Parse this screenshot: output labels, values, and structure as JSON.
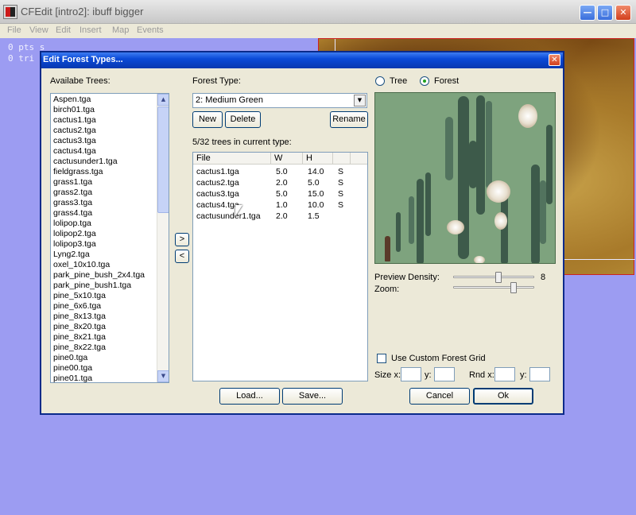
{
  "app": {
    "title": "CFEdit [intro2]: ibuff bigger",
    "menu": [
      "File",
      "View",
      "Edit",
      "Insert",
      "Map",
      "Events"
    ],
    "console": [
      "0 pts s",
      "0 tri"
    ]
  },
  "dialog": {
    "title": "Edit Forest Types...",
    "available_label": "Availabe Trees:",
    "available_trees": [
      "Aspen.tga",
      "birch01.tga",
      "cactus1.tga",
      "cactus2.tga",
      "cactus3.tga",
      "cactus4.tga",
      "cactusunder1.tga",
      "fieldgrass.tga",
      "grass1.tga",
      "grass2.tga",
      "grass3.tga",
      "grass4.tga",
      "lolipop.tga",
      "lolipop2.tga",
      "lolipop3.tga",
      "Lyng2.tga",
      "oxel_10x10.tga",
      "park_pine_bush_2x4.tga",
      "park_pine_bush1.tga",
      "pine_5x10.tga",
      "pine_6x6.tga",
      "pine_8x13.tga",
      "pine_8x20.tga",
      "pine_8x21.tga",
      "pine_8x22.tga",
      "pine0.tga",
      "pine00.tga",
      "pine01.tga"
    ],
    "forest_type_label": "Forest Type:",
    "forest_type_value": "2: Medium Green",
    "new_label": "New",
    "delete_label": "Delete",
    "rename_label": "Rename",
    "count_label": "5/32 trees in current type:",
    "columns": [
      "File",
      "W",
      "H",
      ""
    ],
    "rows": [
      {
        "file": "cactus1.tga",
        "w": "5.0",
        "h": "14.0",
        "s": "S"
      },
      {
        "file": "cactus2.tga",
        "w": "2.0",
        "h": "5.0",
        "s": "S"
      },
      {
        "file": "cactus3.tga",
        "w": "5.0",
        "h": "15.0",
        "s": "S"
      },
      {
        "file": "cactus4.tga",
        "w": "1.0",
        "h": "10.0",
        "s": "S"
      },
      {
        "file": "cactusunder1.tga",
        "w": "2.0",
        "h": "1.5",
        "s": ""
      }
    ],
    "add_arrow": ">",
    "remove_arrow": "<",
    "radio_tree": "Tree",
    "radio_forest": "Forest",
    "preview_density_label": "Preview Density:",
    "preview_density_value": "8",
    "zoom_label": "Zoom:",
    "custom_grid_label": "Use Custom Forest Grid",
    "size_x_label": "Size x:",
    "size_y_label": "y:",
    "rnd_x_label": "Rnd x:",
    "rnd_y_label": "y:",
    "load_label": "Load...",
    "save_label": "Save...",
    "cancel_label": "Cancel",
    "ok_label": "Ok"
  }
}
